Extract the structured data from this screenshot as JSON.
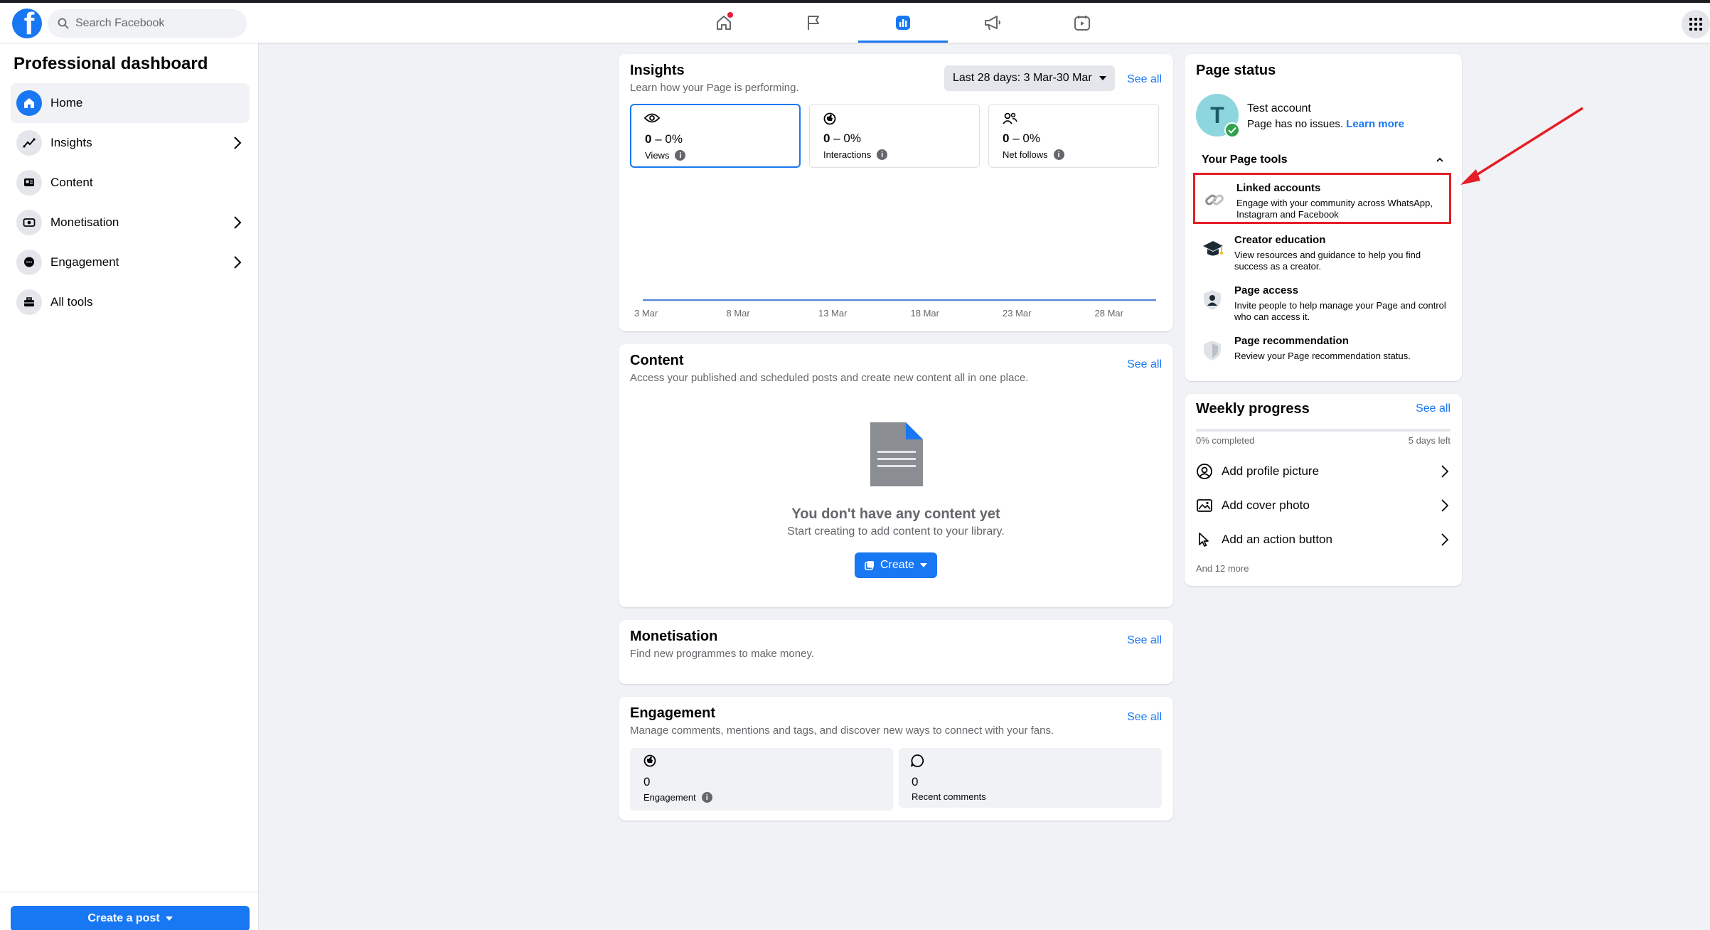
{
  "topbar": {
    "logo": "f",
    "search_placeholder": "Search Facebook",
    "tabs": [
      {
        "name": "home-icon",
        "active": false,
        "badge": true
      },
      {
        "name": "flag-icon",
        "active": false,
        "badge": false
      },
      {
        "name": "insights-chart-icon",
        "active": true,
        "badge": false
      },
      {
        "name": "megaphone-icon",
        "active": false,
        "badge": false
      },
      {
        "name": "video-calendar-icon",
        "active": false,
        "badge": false
      }
    ],
    "apps_icon": "grid-menu-icon"
  },
  "sidebar": {
    "title": "Professional dashboard",
    "items": [
      {
        "label": "Home",
        "icon": "home-icon",
        "active": true,
        "chevron": false
      },
      {
        "label": "Insights",
        "icon": "trend-icon",
        "active": false,
        "chevron": true
      },
      {
        "label": "Content",
        "icon": "content-icon",
        "active": false,
        "chevron": false
      },
      {
        "label": "Monetisation",
        "icon": "money-icon",
        "active": false,
        "chevron": true
      },
      {
        "label": "Engagement",
        "icon": "chat-icon",
        "active": false,
        "chevron": true
      },
      {
        "label": "All tools",
        "icon": "toolbox-icon",
        "active": false,
        "chevron": false
      }
    ],
    "create_post_label": "Create a post"
  },
  "insights": {
    "title": "Insights",
    "subtitle": "Learn how your Page is performing.",
    "date_range": "Last 28 days: 3 Mar-30 Mar",
    "see_all": "See all",
    "metrics": [
      {
        "value": "0",
        "change": "– 0%",
        "label": "Views",
        "icon": "eye-icon"
      },
      {
        "value": "0",
        "change": "– 0%",
        "label": "Interactions",
        "icon": "interactions-icon"
      },
      {
        "value": "0",
        "change": "– 0%",
        "label": "Net follows",
        "icon": "followers-icon"
      }
    ]
  },
  "chart_data": {
    "type": "line",
    "x": [
      "3 Mar",
      "8 Mar",
      "13 Mar",
      "18 Mar",
      "23 Mar",
      "28 Mar"
    ],
    "series": [
      {
        "values": [
          0,
          0,
          0,
          0,
          0,
          0
        ]
      }
    ],
    "title": "",
    "xlabel": "",
    "ylabel": "",
    "grid": false
  },
  "content": {
    "title": "Content",
    "subtitle": "Access your published and scheduled posts and create new content all in one place.",
    "see_all": "See all",
    "empty_title": "You don't have any content yet",
    "empty_sub": "Start creating to add content to your library.",
    "create_label": "Create"
  },
  "monetisation": {
    "title": "Monetisation",
    "subtitle": "Find new programmes to make money.",
    "see_all": "See all"
  },
  "engagement": {
    "title": "Engagement",
    "subtitle": "Manage comments, mentions and tags, and discover new ways to connect with your fans.",
    "see_all": "See all",
    "boxes": [
      {
        "value": "0",
        "label": "Engagement"
      },
      {
        "value": "0",
        "label": "Recent comments"
      }
    ]
  },
  "page_status": {
    "title": "Page status",
    "account_name": "Test account",
    "avatar_letter": "T",
    "status_text": "Page has no issues.",
    "learn_more": "Learn more",
    "tools_title": "Your Page tools",
    "tools": [
      {
        "name": "Linked accounts",
        "desc": "Engage with your community across WhatsApp, Instagram and Facebook",
        "icon": "link-icon",
        "highlight": true
      },
      {
        "name": "Creator education",
        "desc": "View resources and guidance to help you find success as a creator.",
        "icon": "graduation-cap-icon",
        "highlight": false
      },
      {
        "name": "Page access",
        "desc": "Invite people to help manage your Page and control who can access it.",
        "icon": "person-shield-icon",
        "highlight": false
      },
      {
        "name": "Page recommendation",
        "desc": "Review your Page recommendation status.",
        "icon": "shield-icon",
        "highlight": false
      }
    ]
  },
  "weekly_progress": {
    "title": "Weekly progress",
    "see_all": "See all",
    "completed_text": "0% completed",
    "progress": 0,
    "days_left": "5 days left",
    "items": [
      {
        "label": "Add profile picture",
        "icon": "profile-icon"
      },
      {
        "label": "Add cover photo",
        "icon": "photo-icon"
      },
      {
        "label": "Add an action button",
        "icon": "cursor-icon"
      }
    ],
    "more_text": "And 12 more"
  },
  "colors": {
    "brand": "#1877f2",
    "highlight": "#e41e26",
    "background": "#f0f2f5"
  }
}
